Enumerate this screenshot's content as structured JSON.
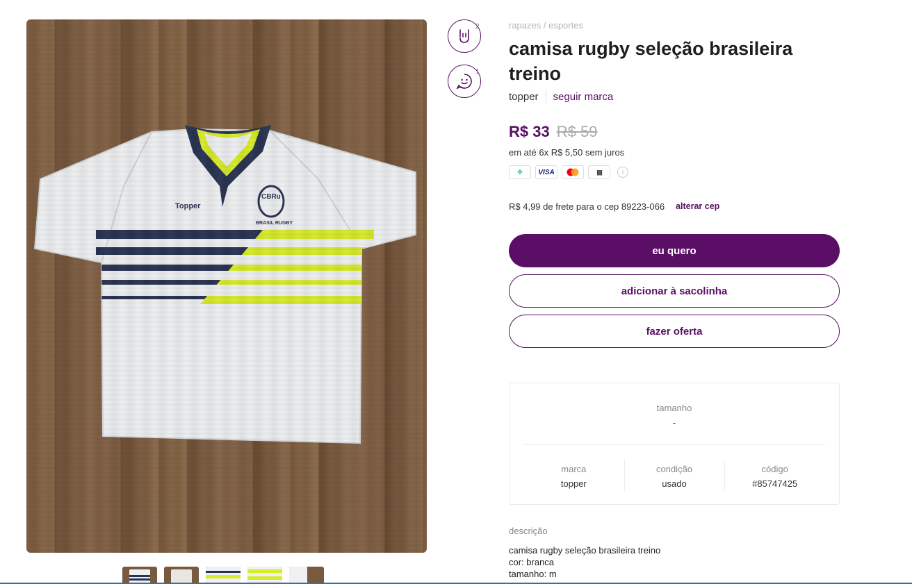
{
  "breadcrumb": "rapazes / esportes",
  "product": {
    "title": "camisa rugby seleção brasileira treino",
    "brand": "topper",
    "follow_label": "seguir marca",
    "price_now": "R$ 33",
    "price_old": "R$ 59",
    "installments": "em até 6x R$ 5,50 sem juros",
    "image_alt": "camisa rugby seleção brasileira treino"
  },
  "payment_methods": [
    {
      "icon": "pix-icon",
      "label": "❖"
    },
    {
      "icon": "visa-icon",
      "label": "VISA"
    },
    {
      "icon": "mastercard-icon",
      "label": ""
    },
    {
      "icon": "boleto-icon",
      "label": "||||||"
    }
  ],
  "shipping": {
    "text": "R$ 4,99 de frete para o cep 89223-066",
    "change_label": "alterar cep"
  },
  "reactions": [
    {
      "icon": "rock-hand-icon",
      "count": "2"
    },
    {
      "icon": "chat-smile-icon",
      "count": "1"
    }
  ],
  "actions": {
    "buy": "eu quero",
    "add_to_bag": "adicionar à sacolinha",
    "offer": "fazer oferta"
  },
  "details": {
    "size_label": "tamanho",
    "size_value": "-",
    "brand_label": "marca",
    "brand_value": "topper",
    "condition_label": "condição",
    "condition_value": "usado",
    "code_label": "código",
    "code_value": "#85747425"
  },
  "description": {
    "label": "descrição",
    "lines": [
      "camisa rugby seleção brasileira treino",
      "cor: branca",
      "tamanho: m"
    ]
  },
  "thumbnails": [
    "thumbnail-1",
    "thumbnail-2",
    "thumbnail-3",
    "thumbnail-4",
    "thumbnail-5"
  ],
  "colors": {
    "brand_purple": "#5b0e66",
    "wood": "#7a5a3e",
    "shirt": "#eef0f2",
    "navy": "#2a3452",
    "lime": "#d8ec2a"
  }
}
